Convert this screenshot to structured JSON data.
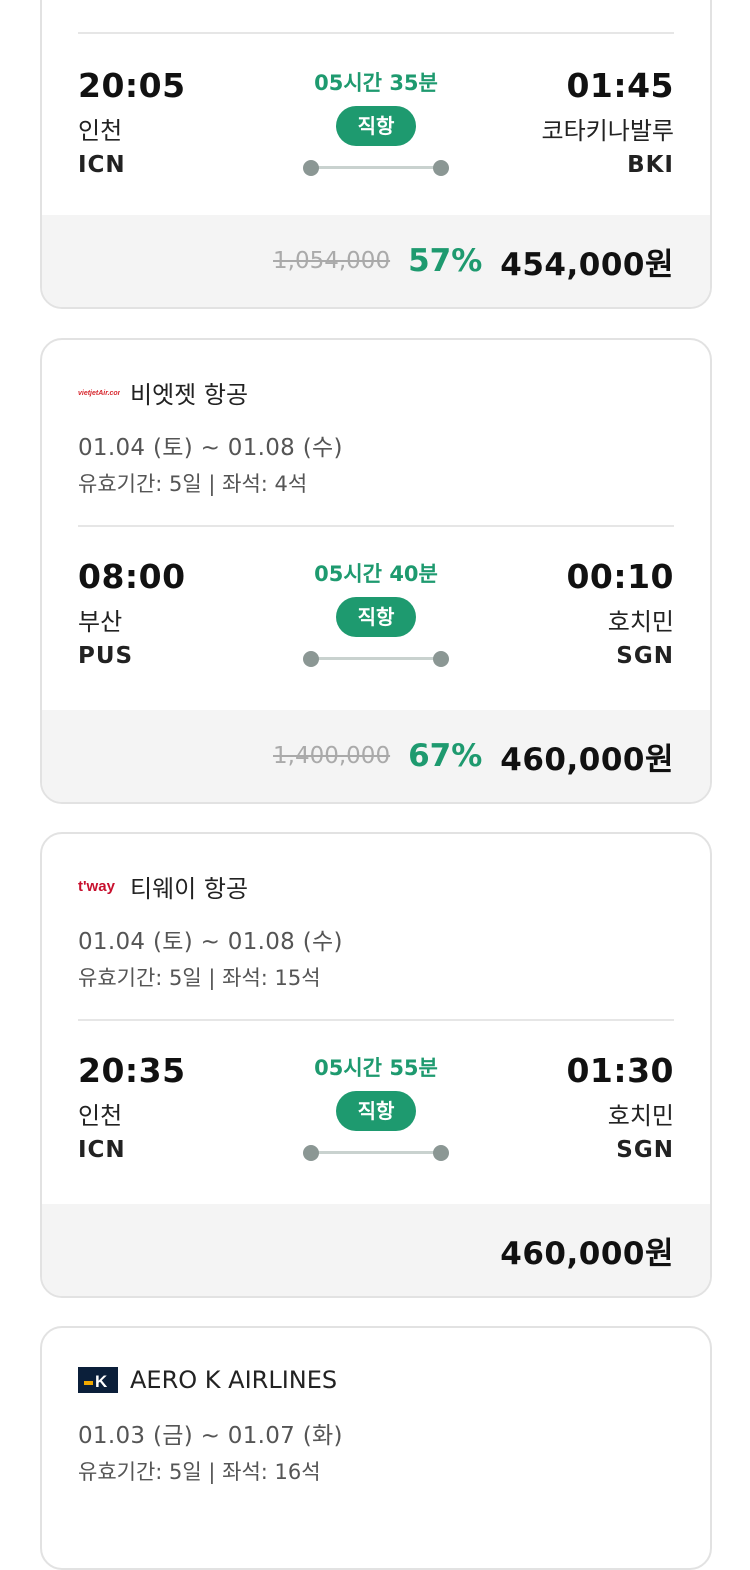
{
  "cards": [
    {
      "flight": {
        "dep_time": "20:05",
        "dep_city": "인천",
        "dep_code": "ICN",
        "duration": "05시간 35분",
        "type": "직항",
        "arr_time": "01:45",
        "arr_city": "코타키나발루",
        "arr_code": "BKI"
      },
      "price": {
        "original": "1,054,000",
        "discount": "57%",
        "final": "454,000원"
      }
    },
    {
      "airline": {
        "name": "비엣젯 항공",
        "logo_icon": "vietjet-logo-icon",
        "logo_text": "vietjetAir.com",
        "logo_color": "#d7262d"
      },
      "dates": "01.04 (토) ~ 01.08 (수)",
      "validity": "유효기간: 5일 | 좌석: 4석",
      "flight": {
        "dep_time": "08:00",
        "dep_city": "부산",
        "dep_code": "PUS",
        "duration": "05시간 40분",
        "type": "직항",
        "arr_time": "00:10",
        "arr_city": "호치민",
        "arr_code": "SGN"
      },
      "price": {
        "original": "1,400,000",
        "discount": "67%",
        "final": "460,000원"
      }
    },
    {
      "airline": {
        "name": "티웨이 항공",
        "logo_icon": "tway-logo-icon",
        "logo_text": "t'way",
        "logo_color": "#c8102e"
      },
      "dates": "01.04 (토) ~ 01.08 (수)",
      "validity": "유효기간: 5일 | 좌석: 15석",
      "flight": {
        "dep_time": "20:35",
        "dep_city": "인천",
        "dep_code": "ICN",
        "duration": "05시간 55분",
        "type": "직항",
        "arr_time": "01:30",
        "arr_city": "호치민",
        "arr_code": "SGN"
      },
      "price": {
        "final": "460,000원"
      }
    },
    {
      "airline": {
        "name": "AERO K AIRLINES",
        "logo_icon": "aerok-logo-icon",
        "logo_text": "K",
        "logo_color": "#0b1f3a"
      },
      "dates": "01.03 (금) ~ 01.07 (화)",
      "validity": "유효기간: 5일 | 좌석: 16석"
    }
  ],
  "colors": {
    "accent": "#1e9a6f",
    "price_bg": "#f4f4f4",
    "strike": "#aaaaaa"
  }
}
